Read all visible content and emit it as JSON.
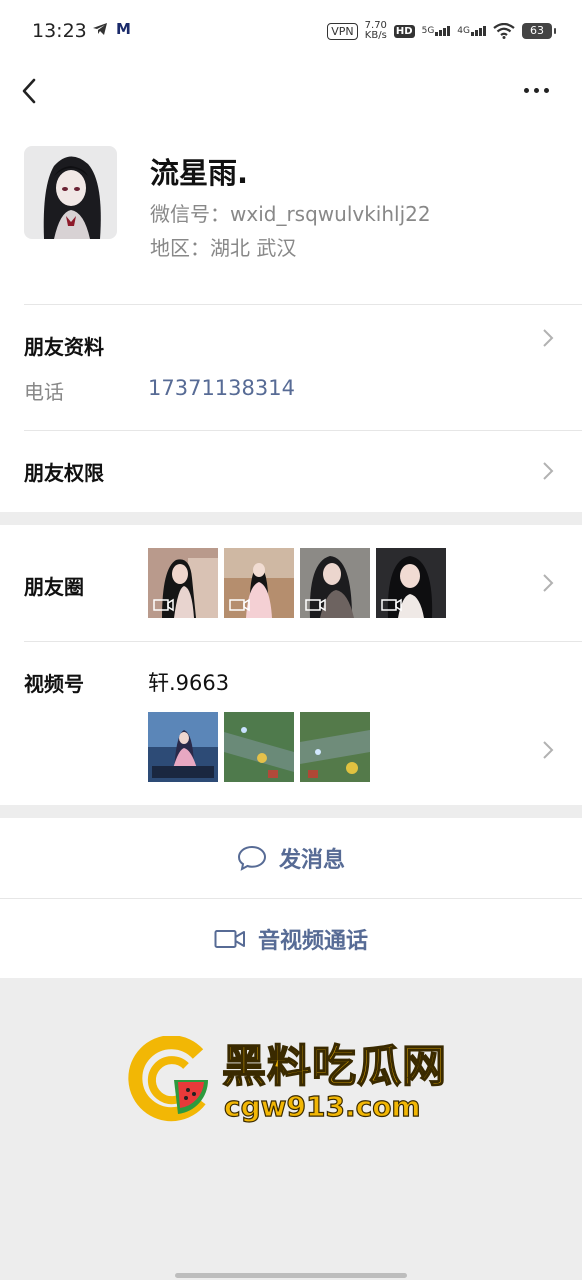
{
  "status_bar": {
    "time": "13:23",
    "m_badge": "M",
    "vpn": "VPN",
    "speed_value": "7.70",
    "speed_unit": "KB/s",
    "hd1": "HD",
    "sim1": "5G",
    "sim2": "4G",
    "battery": "63"
  },
  "nav": {
    "back_icon": "chevron-left-icon",
    "more_icon": "more-dots-icon"
  },
  "profile": {
    "nickname": "流星雨.",
    "wechat_id": "微信号：wxid_rsqwulvkihlj22",
    "region": "地区：湖北  武汉"
  },
  "friend_info": {
    "title": "朋友资料",
    "phone_label": "电话",
    "phone_value": "17371138314"
  },
  "permissions": {
    "title": "朋友权限"
  },
  "moments": {
    "title": "朋友圈",
    "thumb_count_label": ""
  },
  "channels": {
    "title": "视频号",
    "name": "轩.9663"
  },
  "actions": {
    "message": "发消息",
    "call": "音视频通话"
  },
  "watermark": {
    "cn": "黑料吃瓜网",
    "url": "cgw913.com"
  },
  "colors": {
    "link": "#576b95",
    "accent": "#f2b705"
  }
}
